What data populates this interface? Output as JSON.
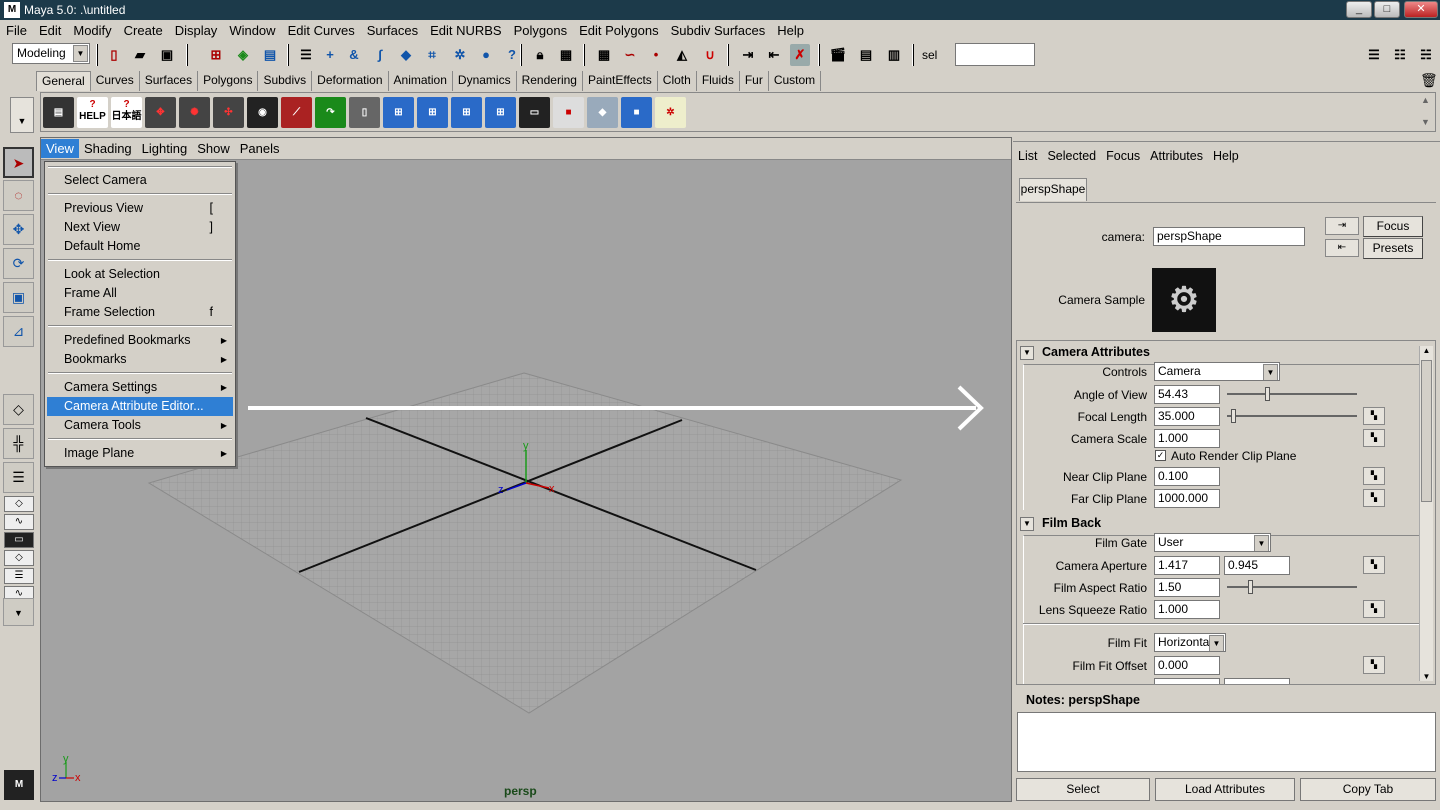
{
  "window": {
    "title": "Maya 5.0: .\\untitled",
    "logo": "M",
    "min": "_",
    "max": "□",
    "close": "✕"
  },
  "menubar": [
    "File",
    "Edit",
    "Modify",
    "Create",
    "Display",
    "Window",
    "Edit Curves",
    "Surfaces",
    "Edit NURBS",
    "Polygons",
    "Edit Polygons",
    "Subdiv Surfaces",
    "Help"
  ],
  "status": {
    "mode": "Modeling",
    "sel_label": "sel"
  },
  "shelf": {
    "tabs": [
      "General",
      "Curves",
      "Surfaces",
      "Polygons",
      "Subdivs",
      "Deformation",
      "Animation",
      "Dynamics",
      "Rendering",
      "PaintEffects",
      "Cloth",
      "Fluids",
      "Fur",
      "Custom"
    ],
    "active_tab": "General",
    "help1": "HELP",
    "help2": "日本語",
    "icons": [
      "help-icon",
      "help-japanese-icon",
      "move-icon",
      "rotate-icon",
      "scale-icon",
      "camera-icon",
      "joint-icon",
      "undo-icon",
      "bucket-icon",
      "graph-icon",
      "graph-icon",
      "graph-icon",
      "graph-icon",
      "script-icon",
      "hypergraph-icon",
      "material-icon",
      "cube-icon",
      "xgrid-icon"
    ]
  },
  "panel": {
    "menus": [
      "View",
      "Shading",
      "Lighting",
      "Show",
      "Panels"
    ],
    "active_menu": "View",
    "camera_label": "persp",
    "axis": {
      "x": "x",
      "y": "y",
      "z": "z"
    }
  },
  "view_menu": {
    "items": [
      {
        "label": "Select Camera",
        "shortcut": "",
        "sub": false
      },
      {
        "label": "Previous View",
        "shortcut": "[",
        "sub": false
      },
      {
        "label": "Next View",
        "shortcut": "]",
        "sub": false
      },
      {
        "label": "Default Home",
        "shortcut": "",
        "sub": false
      },
      {
        "label": "Look at Selection",
        "shortcut": "",
        "sub": false
      },
      {
        "label": "Frame All",
        "shortcut": "",
        "sub": false
      },
      {
        "label": "Frame Selection",
        "shortcut": "f",
        "sub": false
      },
      {
        "label": "Predefined Bookmarks",
        "shortcut": "",
        "sub": true
      },
      {
        "label": "Bookmarks",
        "shortcut": "",
        "sub": true
      },
      {
        "label": "Camera Settings",
        "shortcut": "",
        "sub": true
      },
      {
        "label": "Camera Attribute Editor...",
        "shortcut": "",
        "sub": false,
        "highlighted": true
      },
      {
        "label": "Camera Tools",
        "shortcut": "",
        "sub": true
      },
      {
        "label": "Image Plane",
        "shortcut": "",
        "sub": true
      }
    ],
    "sub_glyph": "▶"
  },
  "attr_editor": {
    "menus": [
      "List",
      "Selected",
      "Focus",
      "Attributes",
      "Help"
    ],
    "tab": "perspShape",
    "camera_label": "camera:",
    "camera_value": "perspShape",
    "focus_btn": "Focus",
    "presets_btn": "Presets",
    "sample_label": "Camera Sample",
    "section1": "Camera Attributes",
    "controls_label": "Controls",
    "controls_value": "Camera",
    "angle_label": "Angle of View",
    "angle_value": "54.43",
    "angle_slider": 0.3,
    "focal_label": "Focal Length",
    "focal_value": "35.000",
    "focal_slider": 0.03,
    "scale_label": "Camera Scale",
    "scale_value": "1.000",
    "auto_clip_label": "Auto Render Clip Plane",
    "auto_clip_checked": true,
    "near_label": "Near Clip Plane",
    "near_value": "0.100",
    "far_label": "Far Clip Plane",
    "far_value": "1000.000",
    "section2": "Film Back",
    "gate_label": "Film Gate",
    "gate_value": "User",
    "aperture_label": "Camera Aperture",
    "aperture_x": "1.417",
    "aperture_y": "0.945",
    "aspect_label": "Film Aspect Ratio",
    "aspect_value": "1.50",
    "aspect_slider": 0.17,
    "squeeze_label": "Lens Squeeze Ratio",
    "squeeze_value": "1.000",
    "fit_label": "Film Fit",
    "fit_value": "Horizontal",
    "fitoffset_label": "Film Fit Offset",
    "fitoffset_value": "0.000",
    "notes_label": "Notes:  perspShape",
    "select_btn": "Select",
    "load_btn": "Load Attributes",
    "copy_btn": "Copy Tab"
  },
  "colors": {
    "highlight": "#2f7fd4",
    "viewport": "#a3a3a3",
    "titlebar": "#1c3a4a"
  }
}
